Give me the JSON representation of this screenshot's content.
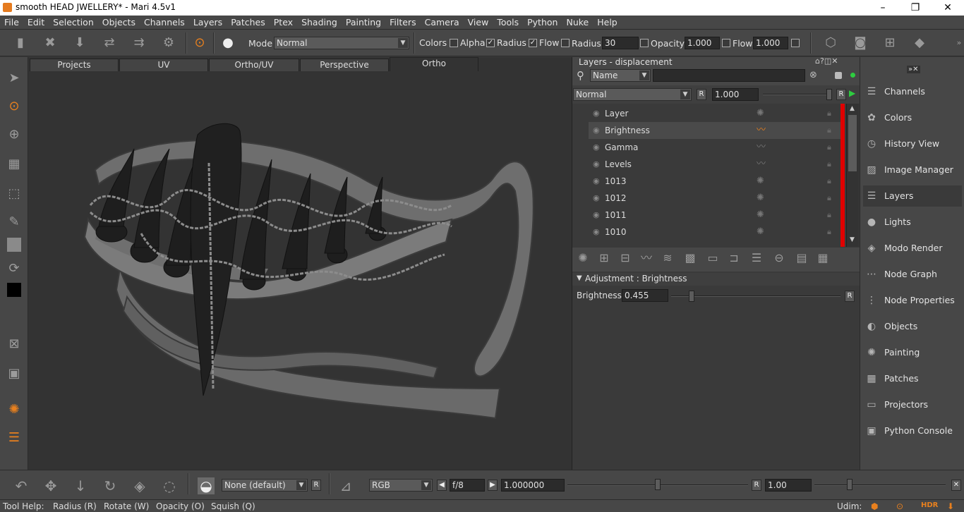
{
  "window": {
    "title": "smooth HEAD JWELLERY* - Mari 4.5v1",
    "min": "–",
    "max": "❐",
    "close": "✕"
  },
  "menu": [
    "File",
    "Edit",
    "Selection",
    "Objects",
    "Channels",
    "Layers",
    "Patches",
    "Ptex",
    "Shading",
    "Painting",
    "Filters",
    "Camera",
    "View",
    "Tools",
    "Python",
    "Nuke",
    "Help"
  ],
  "toolbar": {
    "mode_label": "Mode",
    "mode_value": "Normal",
    "colors_label": "Colors",
    "alpha_label": "Alpha",
    "radius_chk_label": "Radius",
    "flow_chk_label": "Flow",
    "radius_label": "Radius",
    "radius_value": "30",
    "opacity_label": "Opacity",
    "opacity_value": "1.000",
    "flow_label": "Flow",
    "flow_value": "1.000"
  },
  "viewport_tabs": [
    "Projects",
    "UV",
    "Ortho/UV",
    "Perspective",
    "Ortho"
  ],
  "layers_panel": {
    "title": "Layers - displacement",
    "filter_value": "Name",
    "blend_value": "Normal",
    "blend_r": "R",
    "opacity_value": "1.000",
    "opacity_r": "R",
    "rows": [
      {
        "name": "Layer",
        "selected": false
      },
      {
        "name": "Brightness",
        "selected": true
      },
      {
        "name": "Gamma",
        "selected": false
      },
      {
        "name": "Levels",
        "selected": false
      },
      {
        "name": "1013",
        "selected": false
      },
      {
        "name": "1012",
        "selected": false
      },
      {
        "name": "1011",
        "selected": false
      },
      {
        "name": "1010",
        "selected": false
      }
    ],
    "adjustment_header": "Adjustment : Brightness",
    "brightness_label": "Brightness",
    "brightness_value": "0.455",
    "brightness_fraction": 0.12,
    "brightness_r": "R"
  },
  "dock": [
    "Channels",
    "Colors",
    "History View",
    "Image Manager",
    "Layers",
    "Lights",
    "Modo Render",
    "Node Graph",
    "Node Properties",
    "Objects",
    "Painting",
    "Patches",
    "Projectors",
    "Python Console"
  ],
  "dock_active": "Layers",
  "bottom": {
    "paint_value": "None (default)",
    "paint_r": "R",
    "color_value": "RGB",
    "fstop_value": "f/8",
    "exposure_value": "1.000000",
    "exposure_r": "R",
    "gamma_value": "1.00"
  },
  "status": {
    "tool_help": "Tool Help:",
    "hint1": "Radius (R)",
    "hint2": "Rotate (W)",
    "hint3": "Opacity (O)",
    "hint4": "Squish (Q)",
    "udim": "Udim:",
    "hdr": "HDR"
  },
  "colors": {
    "accent": "#e8801e",
    "red_marker": "#e00000",
    "green_dot": "#2ecc40"
  }
}
